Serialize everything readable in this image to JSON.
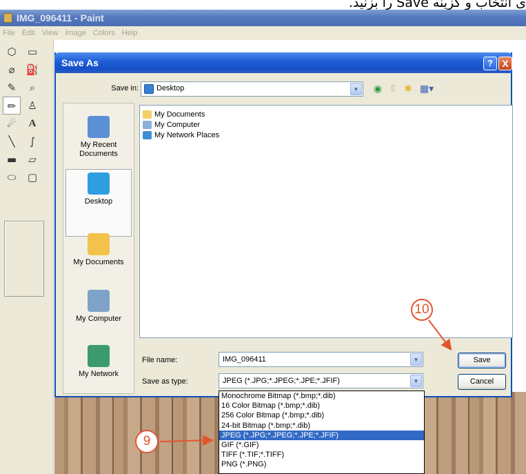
{
  "caption": "ی انتخاب و گزینه Save را بزنید.",
  "paint": {
    "title": "IMG_096411 - Paint",
    "menu": [
      "File",
      "Edit",
      "View",
      "Image",
      "Colors",
      "Help"
    ]
  },
  "dialog": {
    "title": "Save As",
    "help_label": "?",
    "close_label": "X",
    "save_in_label": "Save in:",
    "save_in_value": "Desktop",
    "places": [
      {
        "label": "My Recent Documents",
        "icon": "recent-documents-icon",
        "color": "#5b8fd6"
      },
      {
        "label": "Desktop",
        "icon": "desktop-icon",
        "color": "#2f9ee0",
        "selected": true
      },
      {
        "label": "My Documents",
        "icon": "my-documents-icon",
        "color": "#f2c24a"
      },
      {
        "label": "My Computer",
        "icon": "my-computer-icon",
        "color": "#7fa3c8"
      },
      {
        "label": "My Network",
        "icon": "my-network-icon",
        "color": "#3c9a6f"
      }
    ],
    "files": [
      {
        "name": "My Documents",
        "icon": "folder-icon",
        "color": "#f3cf67"
      },
      {
        "name": "My Computer",
        "icon": "computer-icon",
        "color": "#8bb0d8"
      },
      {
        "name": "My Network Places",
        "icon": "network-icon",
        "color": "#3e8fd0"
      }
    ],
    "file_name_label": "File name:",
    "file_name_value": "IMG_096411",
    "save_as_type_label": "Save as type:",
    "save_as_type_value": "JPEG (*.JPG;*.JPEG;*.JPE;*.JFIF)",
    "save_button": "Save",
    "cancel_button": "Cancel",
    "type_options": [
      "Monochrome Bitmap (*.bmp;*.dib)",
      "16 Color Bitmap (*.bmp;*.dib)",
      "256 Color Bitmap (*.bmp;*.dib)",
      "24-bit Bitmap (*.bmp;*.dib)",
      "JPEG (*.JPG;*.JPEG;*.JPE;*.JFIF)",
      "GIF (*.GIF)",
      "TIFF (*.TIF;*.TIFF)",
      "PNG (*.PNG)"
    ],
    "selected_type_index": 4
  },
  "annotations": {
    "step_9": "9",
    "step_10": "10",
    "color": "#e2552f"
  }
}
